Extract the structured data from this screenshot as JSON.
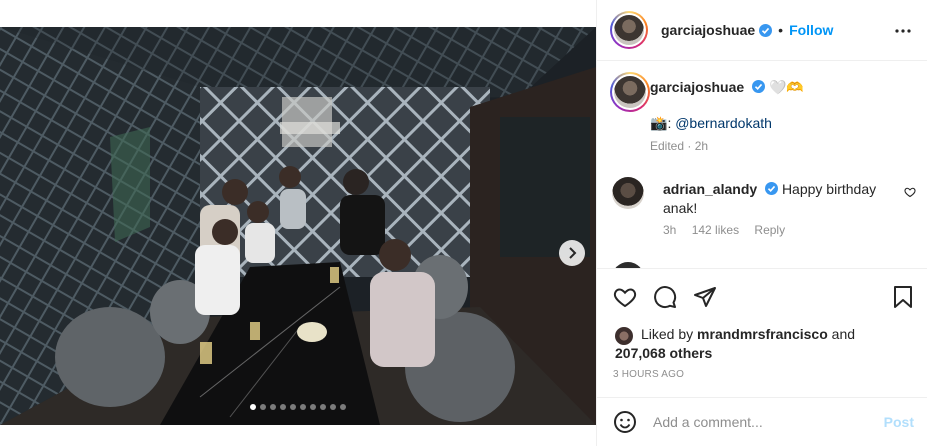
{
  "post": {
    "username": "garciajoshuae",
    "follow_label": "Follow",
    "separator": "•",
    "carousel": {
      "total_slides": 10,
      "active_index": 0
    }
  },
  "caption": {
    "username": "garciajoshuae",
    "emoji": "🤍🫶",
    "camera_emoji": "📸",
    "mention": "@bernardokath",
    "meta": "Edited · 2h"
  },
  "comment": {
    "username": "adrian_alandy",
    "text": "Happy birthday anak!",
    "time": "3h",
    "likes": "142 likes",
    "reply_label": "Reply"
  },
  "likes": {
    "prefix": "Liked by",
    "user": "mrandmrsfrancisco",
    "and": "and",
    "count": "207,068 others"
  },
  "time_ago": "3 HOURS AGO",
  "add_comment": {
    "placeholder": "Add a comment...",
    "post_label": "Post"
  },
  "colors": {
    "accent": "#0095f6",
    "verified": "#3897f0",
    "muted": "#8e8e8e",
    "post_disabled": "#b2dffc"
  },
  "icons": [
    "more-icon",
    "heart-icon",
    "comment-icon",
    "share-icon",
    "save-icon",
    "emoji-icon",
    "chevron-right-icon",
    "verified-icon"
  ]
}
